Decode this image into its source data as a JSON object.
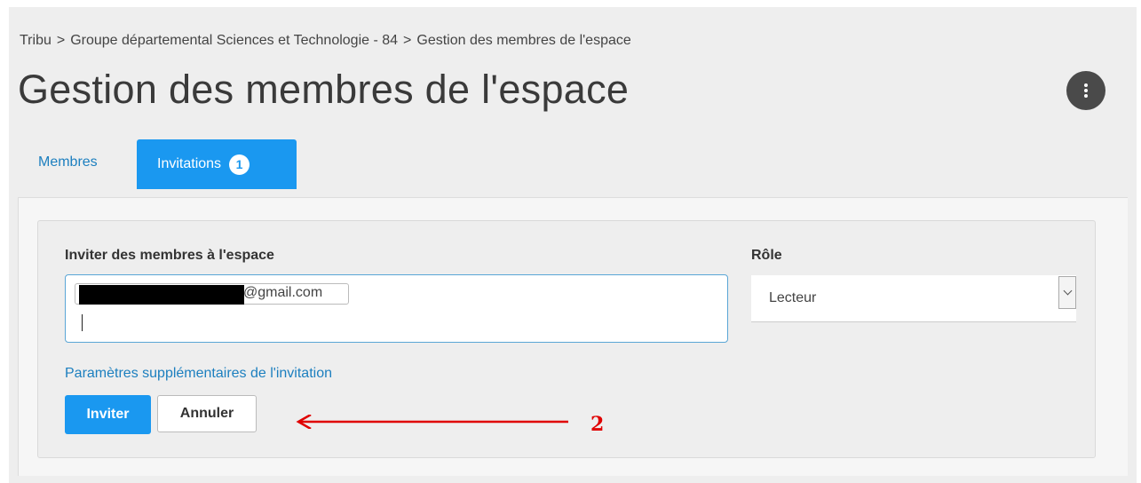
{
  "breadcrumb": {
    "items": [
      "Tribu",
      "Groupe départemental Sciences et Technologie - 84",
      "Gestion des membres de l'espace"
    ],
    "separator": ">"
  },
  "page_title": "Gestion des membres de l'espace",
  "menu_button": {
    "icon": "vertical-ellipsis-icon"
  },
  "tabs": {
    "membres": "Membres",
    "invitations": "Invitations",
    "invitations_badge": "1",
    "active": "invitations"
  },
  "invite_form": {
    "label": "Inviter des membres à l'espace",
    "email_chip_suffix": "@gmail.com",
    "role_label": "Rôle",
    "role_value": "Lecteur",
    "advanced_link": "Paramètres supplémentaires de l'invitation",
    "invite_button": "Inviter",
    "cancel_button": "Annuler"
  },
  "annotation": {
    "label": "2",
    "color": "#e00000"
  },
  "colors": {
    "accent": "#1a98f0",
    "link": "#1c7fbf",
    "page_background": "#eeeeee"
  }
}
